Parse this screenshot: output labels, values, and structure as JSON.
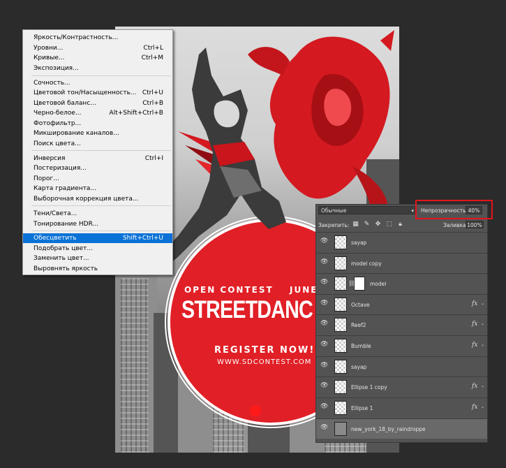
{
  "poster": {
    "open_contest": "OPEN CONTEST",
    "june": "JUNE",
    "title": "STREETDANC",
    "register": "REGISTER NOW!",
    "website": "WWW.SDCONTEST.COM"
  },
  "menu": {
    "items": [
      {
        "label": "Яркость/Контрастность...",
        "shortcut": ""
      },
      {
        "label": "Уровни...",
        "shortcut": "Ctrl+L"
      },
      {
        "label": "Кривые...",
        "shortcut": "Ctrl+M"
      },
      {
        "label": "Экспозиция...",
        "shortcut": ""
      },
      {
        "label": "Сочность...",
        "shortcut": ""
      },
      {
        "label": "Цветовой тон/Насыщенность...",
        "shortcut": "Ctrl+U"
      },
      {
        "label": "Цветовой баланс...",
        "shortcut": "Ctrl+B"
      },
      {
        "label": "Черно-белое...",
        "shortcut": "Alt+Shift+Ctrl+B"
      },
      {
        "label": "Фотофильтр...",
        "shortcut": ""
      },
      {
        "label": "Микширование каналов...",
        "shortcut": ""
      },
      {
        "label": "Поиск цвета...",
        "shortcut": ""
      },
      {
        "label": "Инверсия",
        "shortcut": "Ctrl+I"
      },
      {
        "label": "Постеризация...",
        "shortcut": ""
      },
      {
        "label": "Порог...",
        "shortcut": ""
      },
      {
        "label": "Карта градиента...",
        "shortcut": ""
      },
      {
        "label": "Выборочная коррекция цвета...",
        "shortcut": ""
      },
      {
        "label": "Тени/Света...",
        "shortcut": ""
      },
      {
        "label": "Тонирование HDR...",
        "shortcut": ""
      },
      {
        "label": "Обесцветить",
        "shortcut": "Shift+Ctrl+U"
      },
      {
        "label": "Подобрать цвет...",
        "shortcut": ""
      },
      {
        "label": "Заменить цвет...",
        "shortcut": ""
      },
      {
        "label": "Выровнять яркость",
        "shortcut": ""
      }
    ],
    "selected_index": 18
  },
  "layers_panel": {
    "blend_mode": "Обычные",
    "opacity_label": "Непрозрачность:",
    "opacity_value": "40%",
    "lock_label": "Закрепить:",
    "fill_label": "Заливка:",
    "fill_value": "100%",
    "layers": [
      {
        "name": "sayap",
        "fx": false
      },
      {
        "name": "model copy",
        "fx": false
      },
      {
        "name": "model",
        "fx": false,
        "mask": true
      },
      {
        "name": "Octave",
        "fx": true
      },
      {
        "name": "Reef2",
        "fx": true
      },
      {
        "name": "Bumble",
        "fx": true
      },
      {
        "name": "sayap",
        "fx": false
      },
      {
        "name": "Ellipse 1 copy",
        "fx": true
      },
      {
        "name": "Ellipse 1",
        "fx": true
      },
      {
        "name": "new_york_18_by_raindroppe",
        "fx": false
      }
    ],
    "fx_symbol": "fx",
    "selected_layer": "new_york_18_by_raindroppe"
  },
  "colors": {
    "accent_red": "#e11f26",
    "menu_highlight": "#0a72d6",
    "panel_bg": "#535353"
  }
}
